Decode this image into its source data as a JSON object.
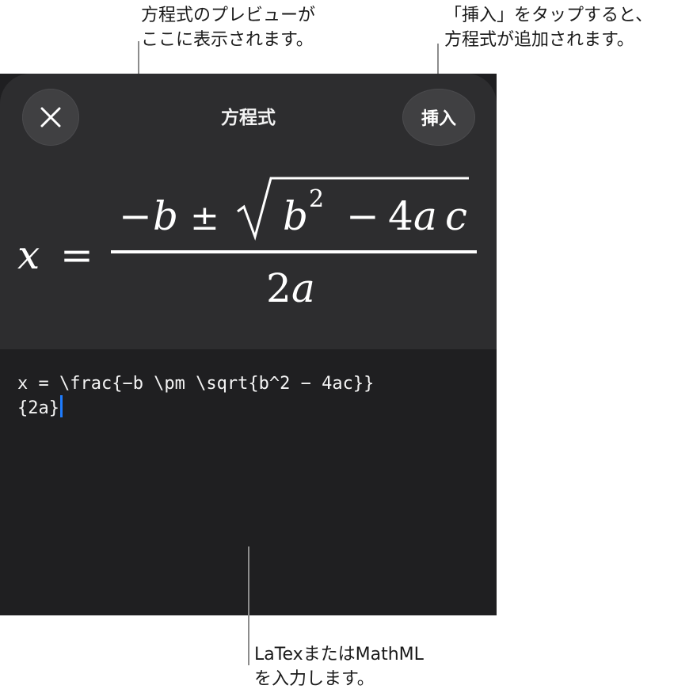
{
  "callouts": {
    "preview": "方程式のプレビューが\nここに表示されます。",
    "insert": "「挿入」をタップすると、\n方程式が追加されます。",
    "input": "LaTexまたはMathML\nを入力します。"
  },
  "sheet": {
    "title": "方程式",
    "insert_label": "挿入",
    "close_icon": "close-icon"
  },
  "preview": {
    "lhs": "x",
    "equals": "=",
    "numerator": {
      "minus": "−",
      "b": "b",
      "pm": "±",
      "radicand_b": "b",
      "exponent": "2",
      "minus2": "−",
      "coef": "4",
      "a": "a",
      "c": "c"
    },
    "denominator": {
      "coef": "2",
      "a": "a"
    }
  },
  "editor": {
    "latex_line1": "x = \\frac{−b \\pm \\sqrt{b^2 − 4ac}}",
    "latex_line2": "{2a}"
  },
  "colors": {
    "panel": "#1f1f21",
    "sheet": "#2d2d2f",
    "caret": "#1e7cff"
  }
}
